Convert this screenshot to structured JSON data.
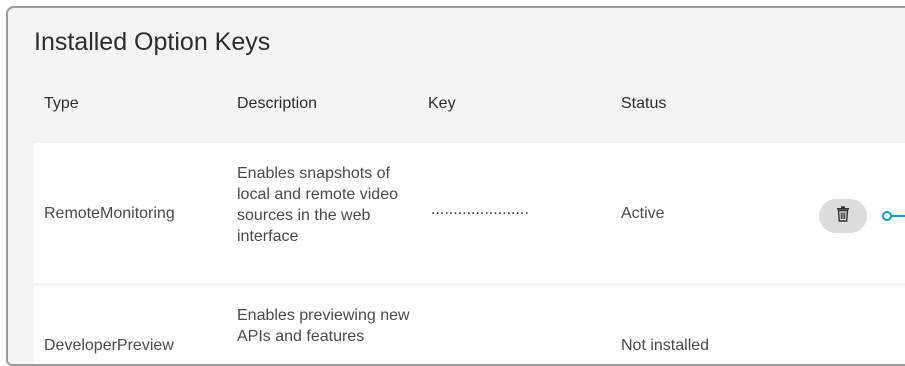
{
  "panel": {
    "title": "Installed Option Keys"
  },
  "table": {
    "columns": [
      "Type",
      "Description",
      "Key",
      "Status"
    ],
    "rows": [
      {
        "type": "RemoteMonitoring",
        "description": "Enables snapshots of local and remote video sources in the web interface",
        "key": "......................",
        "status": "Active"
      },
      {
        "type": "DeveloperPreview",
        "description": "Enables previewing new APIs and features",
        "key": "",
        "status": "Not installed"
      }
    ]
  },
  "icons": {
    "delete": "trash-icon",
    "toggle": "toggle-icon"
  },
  "colors": {
    "accent": "#00a0c6",
    "panel_bg": "#f4f4f4",
    "row_bg": "#ffffff",
    "button_bg": "#dcdcdc"
  }
}
